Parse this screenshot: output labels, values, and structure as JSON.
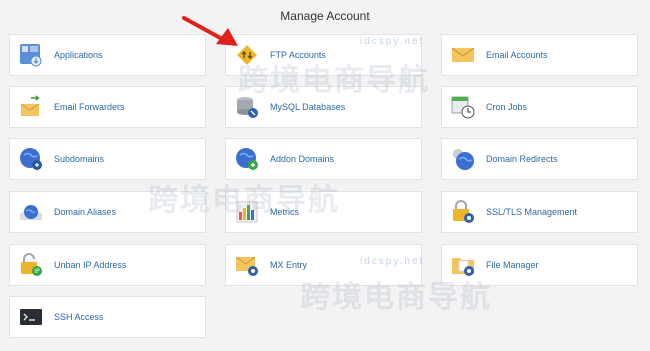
{
  "page": {
    "title": "Manage Account"
  },
  "tiles": [
    {
      "label": "Applications",
      "icon": "applications-icon"
    },
    {
      "label": "FTP Accounts",
      "icon": "ftp-icon"
    },
    {
      "label": "Email Accounts",
      "icon": "email-icon"
    },
    {
      "label": "Email Forwarders",
      "icon": "email-forwarder-icon"
    },
    {
      "label": "MySQL Databases",
      "icon": "database-icon"
    },
    {
      "label": "Cron Jobs",
      "icon": "cron-icon"
    },
    {
      "label": "Subdomains",
      "icon": "subdomain-globe-icon"
    },
    {
      "label": "Addon Domains",
      "icon": "addon-globe-icon"
    },
    {
      "label": "Domain Redirects",
      "icon": "redirect-globe-icon"
    },
    {
      "label": "Domain Aliases",
      "icon": "alias-globe-icon"
    },
    {
      "label": "Metrics",
      "icon": "metrics-chart-icon"
    },
    {
      "label": "SSL/TLS Management",
      "icon": "ssl-lock-icon"
    },
    {
      "label": "Unban IP Address",
      "icon": "unban-lock-icon"
    },
    {
      "label": "MX Entry",
      "icon": "mx-mail-icon"
    },
    {
      "label": "File Manager",
      "icon": "folder-icon"
    },
    {
      "label": "SSH Access",
      "icon": "terminal-icon"
    }
  ],
  "watermark": {
    "text": "跨境电商导航",
    "sub": "idcspy.net"
  },
  "colors": {
    "background": "#f3f3f3",
    "link": "#2a6aa8",
    "arrow": "#e0201b"
  }
}
